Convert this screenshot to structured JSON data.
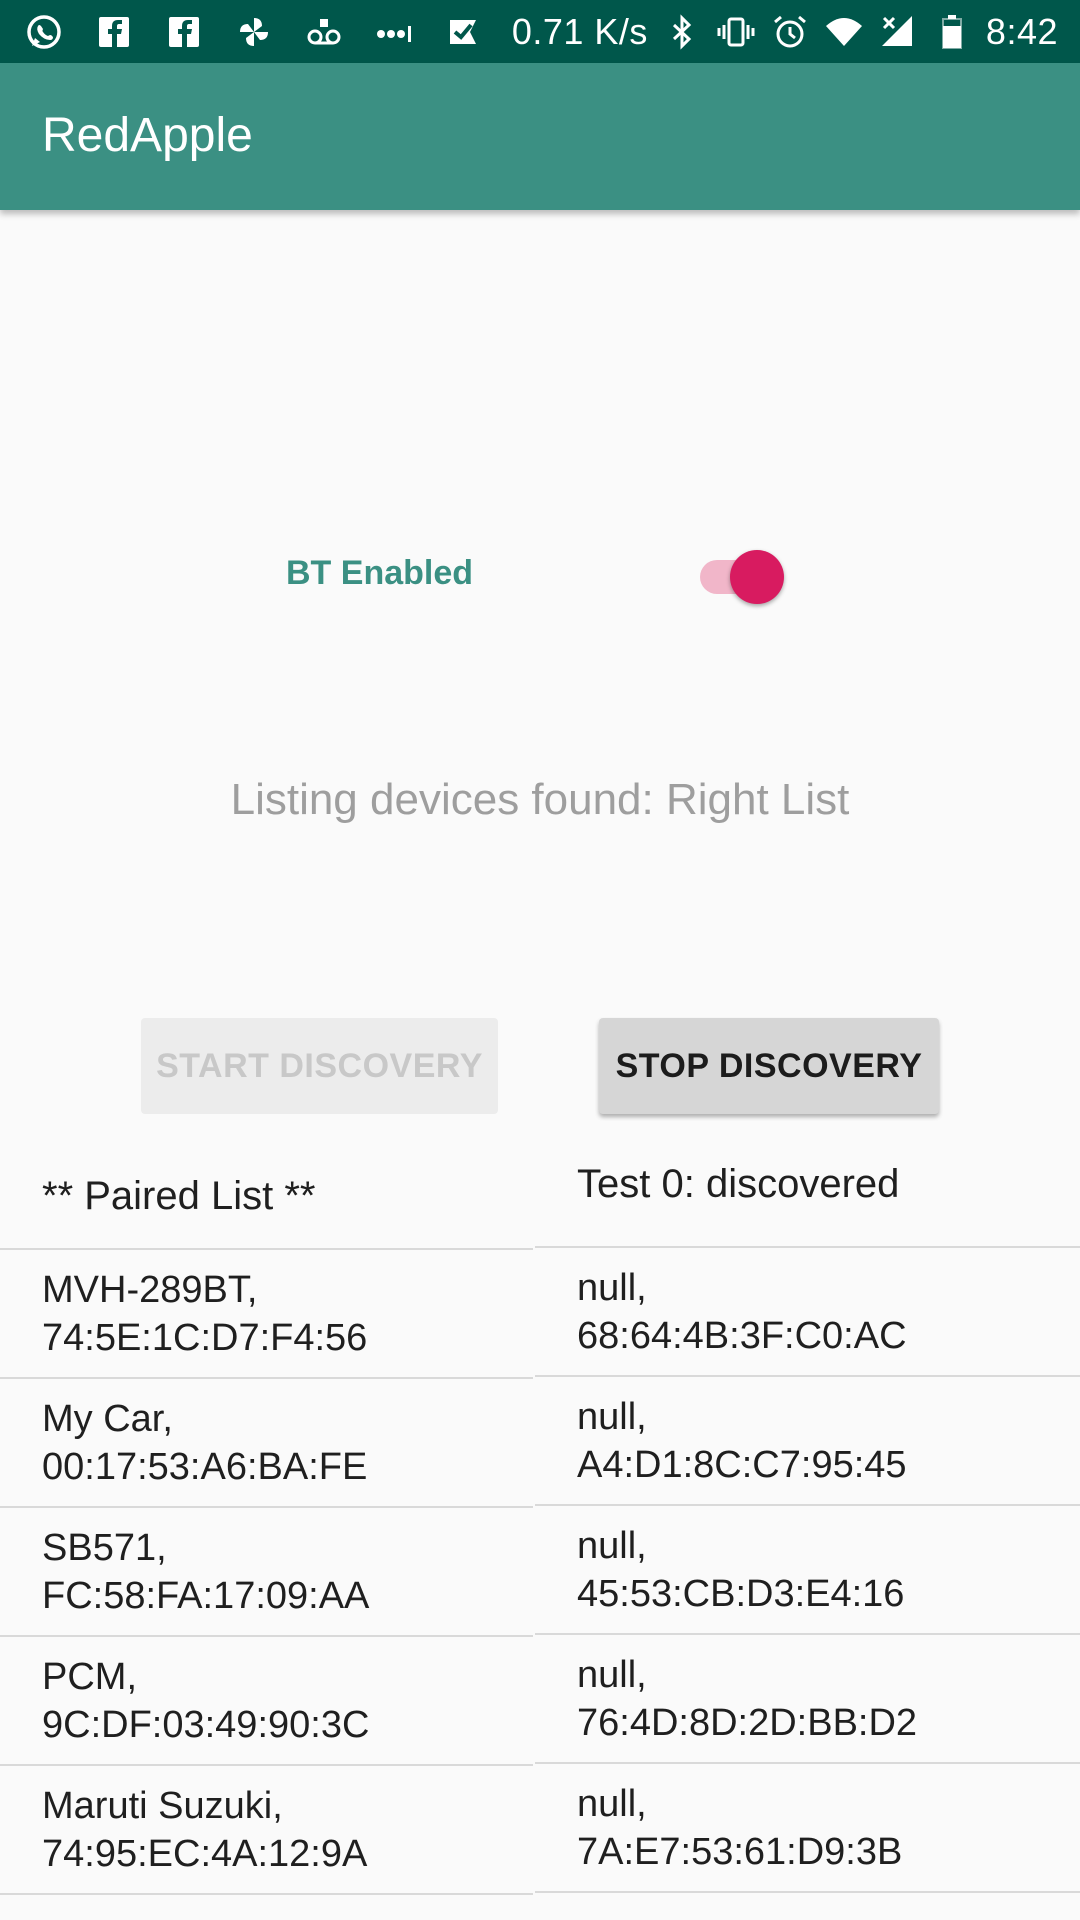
{
  "status_bar": {
    "left_icons": [
      "whatsapp-icon",
      "facebook-icon",
      "facebook-icon",
      "pinwheel-icon",
      "voicemail-icon",
      "more-dots-icon",
      "check-flag-icon"
    ],
    "speed": "0.71 K/s",
    "right_icons": [
      "bluetooth-icon",
      "vibrate-icon",
      "alarm-icon",
      "wifi-icon",
      "signal-icon",
      "battery-icon"
    ],
    "time": "8:42"
  },
  "app_bar": {
    "title": "RedApple"
  },
  "bt": {
    "label": "BT Enabled",
    "enabled": true
  },
  "listing_status": "Listing devices found: Right List",
  "buttons": {
    "start": "START DISCOVERY",
    "stop": "STOP DISCOVERY"
  },
  "paired_list": {
    "header": "** Paired List **",
    "items": [
      {
        "name": "MVH-289BT,",
        "address": "74:5E:1C:D7:F4:56"
      },
      {
        "name": "My Car,",
        "address": "00:17:53:A6:BA:FE"
      },
      {
        "name": "SB571,",
        "address": "FC:58:FA:17:09:AA"
      },
      {
        "name": "PCM,",
        "address": "9C:DF:03:49:90:3C"
      },
      {
        "name": "Maruti Suzuki,",
        "address": "74:95:EC:4A:12:9A"
      }
    ]
  },
  "discovered_list": {
    "header": "Test 0: discovered",
    "items": [
      {
        "name": "null,",
        "address": "68:64:4B:3F:C0:AC"
      },
      {
        "name": "null,",
        "address": "A4:D1:8C:C7:95:45"
      },
      {
        "name": "null,",
        "address": "45:53:CB:D3:E4:16"
      },
      {
        "name": "null,",
        "address": "76:4D:8D:2D:BB:D2"
      },
      {
        "name": "null,",
        "address": "7A:E7:53:61:D9:3B"
      }
    ]
  }
}
